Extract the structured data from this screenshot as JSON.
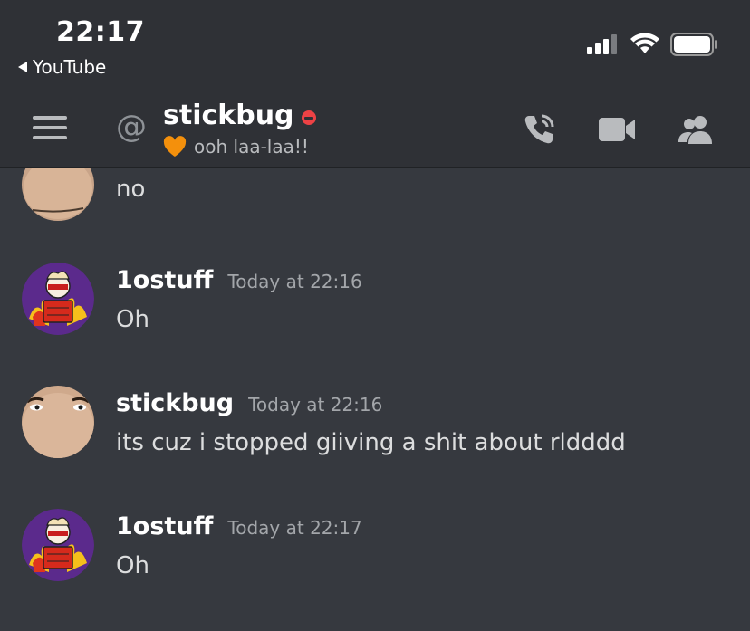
{
  "status_bar": {
    "time": "22:17",
    "back_app": "YouTube",
    "icons": [
      "signal-icon",
      "wifi-icon",
      "battery-icon"
    ]
  },
  "header": {
    "menu_icon": "hamburger-menu-icon",
    "at_icon": "@",
    "channel_name": "stickbug",
    "presence": "do-not-disturb",
    "status_emoji": "orange-heart",
    "status_text": "ooh laa-laa!!",
    "actions": [
      "voice-call-icon",
      "video-call-icon",
      "members-icon"
    ]
  },
  "messages": [
    {
      "author": "",
      "timestamp": "",
      "text": "no",
      "avatar": "stickbug-avatar",
      "continuation": true
    },
    {
      "author": "1ostuff",
      "timestamp": "Today at 22:16",
      "text": "Oh",
      "avatar": "1ostuff-avatar"
    },
    {
      "author": "stickbug",
      "timestamp": "Today at 22:16",
      "text": "its cuz i stopped giiving a shit about rldddd",
      "avatar": "stickbug-avatar"
    },
    {
      "author": "1ostuff",
      "timestamp": "Today at 22:17",
      "text": "Oh",
      "avatar": "1ostuff-avatar"
    }
  ],
  "colors": {
    "background": "#36393f",
    "header": "#2f3136",
    "dnd": "#ed4245",
    "avatar_purple": "#5b2a8c"
  }
}
